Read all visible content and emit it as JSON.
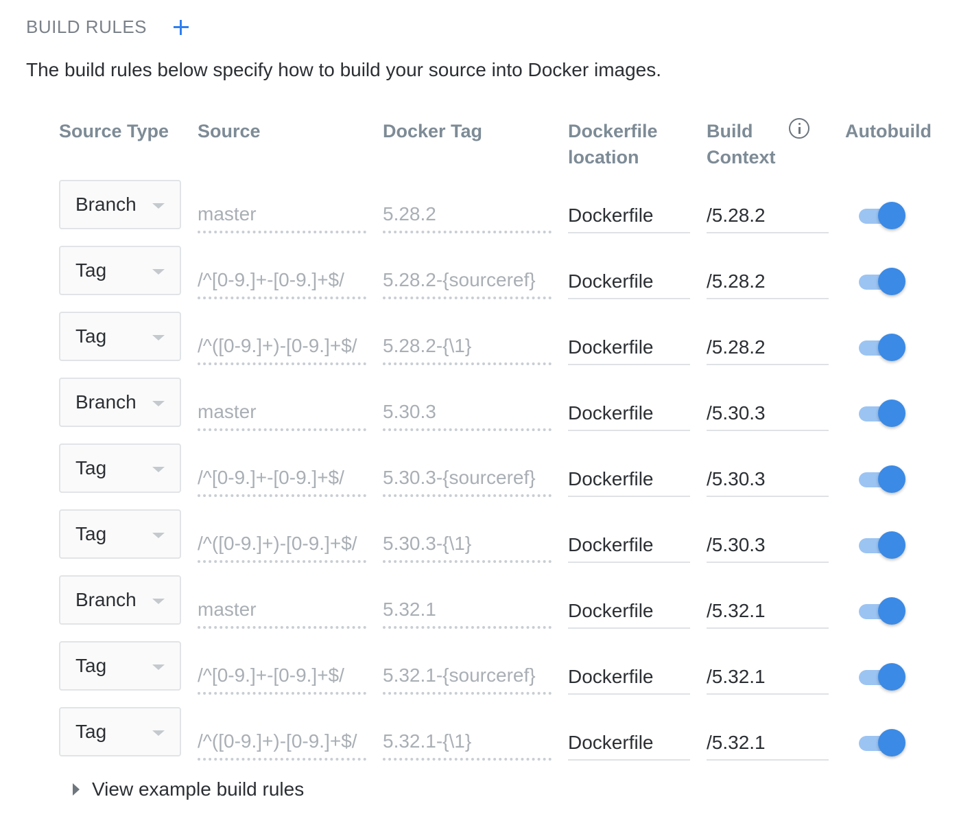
{
  "header": {
    "title": "BUILD RULES",
    "add_icon": "plus-icon",
    "description": "The build rules below specify how to build your source into Docker images."
  },
  "columns": {
    "source_type": "Source Type",
    "source": "Source",
    "docker_tag": "Docker Tag",
    "dockerfile_location": [
      "Dockerfile",
      "location"
    ],
    "build_context": [
      "Build",
      "Context"
    ],
    "build_context_icon": "info-icon",
    "autobuild": "Autobuild"
  },
  "rules": [
    {
      "source_type": "Branch",
      "source": "master",
      "docker_tag": "5.28.2",
      "dockerfile": "Dockerfile",
      "context": "/5.28.2",
      "autobuild": true
    },
    {
      "source_type": "Tag",
      "source": "/^[0-9.]+-[0-9.]+$/",
      "docker_tag": "5.28.2-{sourceref}",
      "dockerfile": "Dockerfile",
      "context": "/5.28.2",
      "autobuild": true
    },
    {
      "source_type": "Tag",
      "source": "/^([0-9.]+)-[0-9.]+$/",
      "docker_tag": "5.28.2-{\\1}",
      "dockerfile": "Dockerfile",
      "context": "/5.28.2",
      "autobuild": true
    },
    {
      "source_type": "Branch",
      "source": "master",
      "docker_tag": "5.30.3",
      "dockerfile": "Dockerfile",
      "context": "/5.30.3",
      "autobuild": true
    },
    {
      "source_type": "Tag",
      "source": "/^[0-9.]+-[0-9.]+$/",
      "docker_tag": "5.30.3-{sourceref}",
      "dockerfile": "Dockerfile",
      "context": "/5.30.3",
      "autobuild": true
    },
    {
      "source_type": "Tag",
      "source": "/^([0-9.]+)-[0-9.]+$/",
      "docker_tag": "5.30.3-{\\1}",
      "dockerfile": "Dockerfile",
      "context": "/5.30.3",
      "autobuild": true
    },
    {
      "source_type": "Branch",
      "source": "master",
      "docker_tag": "5.32.1",
      "dockerfile": "Dockerfile",
      "context": "/5.32.1",
      "autobuild": true
    },
    {
      "source_type": "Tag",
      "source": "/^[0-9.]+-[0-9.]+$/",
      "docker_tag": "5.32.1-{sourceref}",
      "dockerfile": "Dockerfile",
      "context": "/5.32.1",
      "autobuild": true
    },
    {
      "source_type": "Tag",
      "source": "/^([0-9.]+)-[0-9.]+$/",
      "docker_tag": "5.32.1-{\\1}",
      "dockerfile": "Dockerfile",
      "context": "/5.32.1",
      "autobuild": true
    }
  ],
  "footer": {
    "example_link": "View example build rules",
    "disclosure_icon": "triangle-right-icon"
  },
  "colors": {
    "accent": "#3b8ae6",
    "toggle_track": "#9cc4f2",
    "header_text": "#7d8b96",
    "placeholder_text": "#a9afb5"
  }
}
